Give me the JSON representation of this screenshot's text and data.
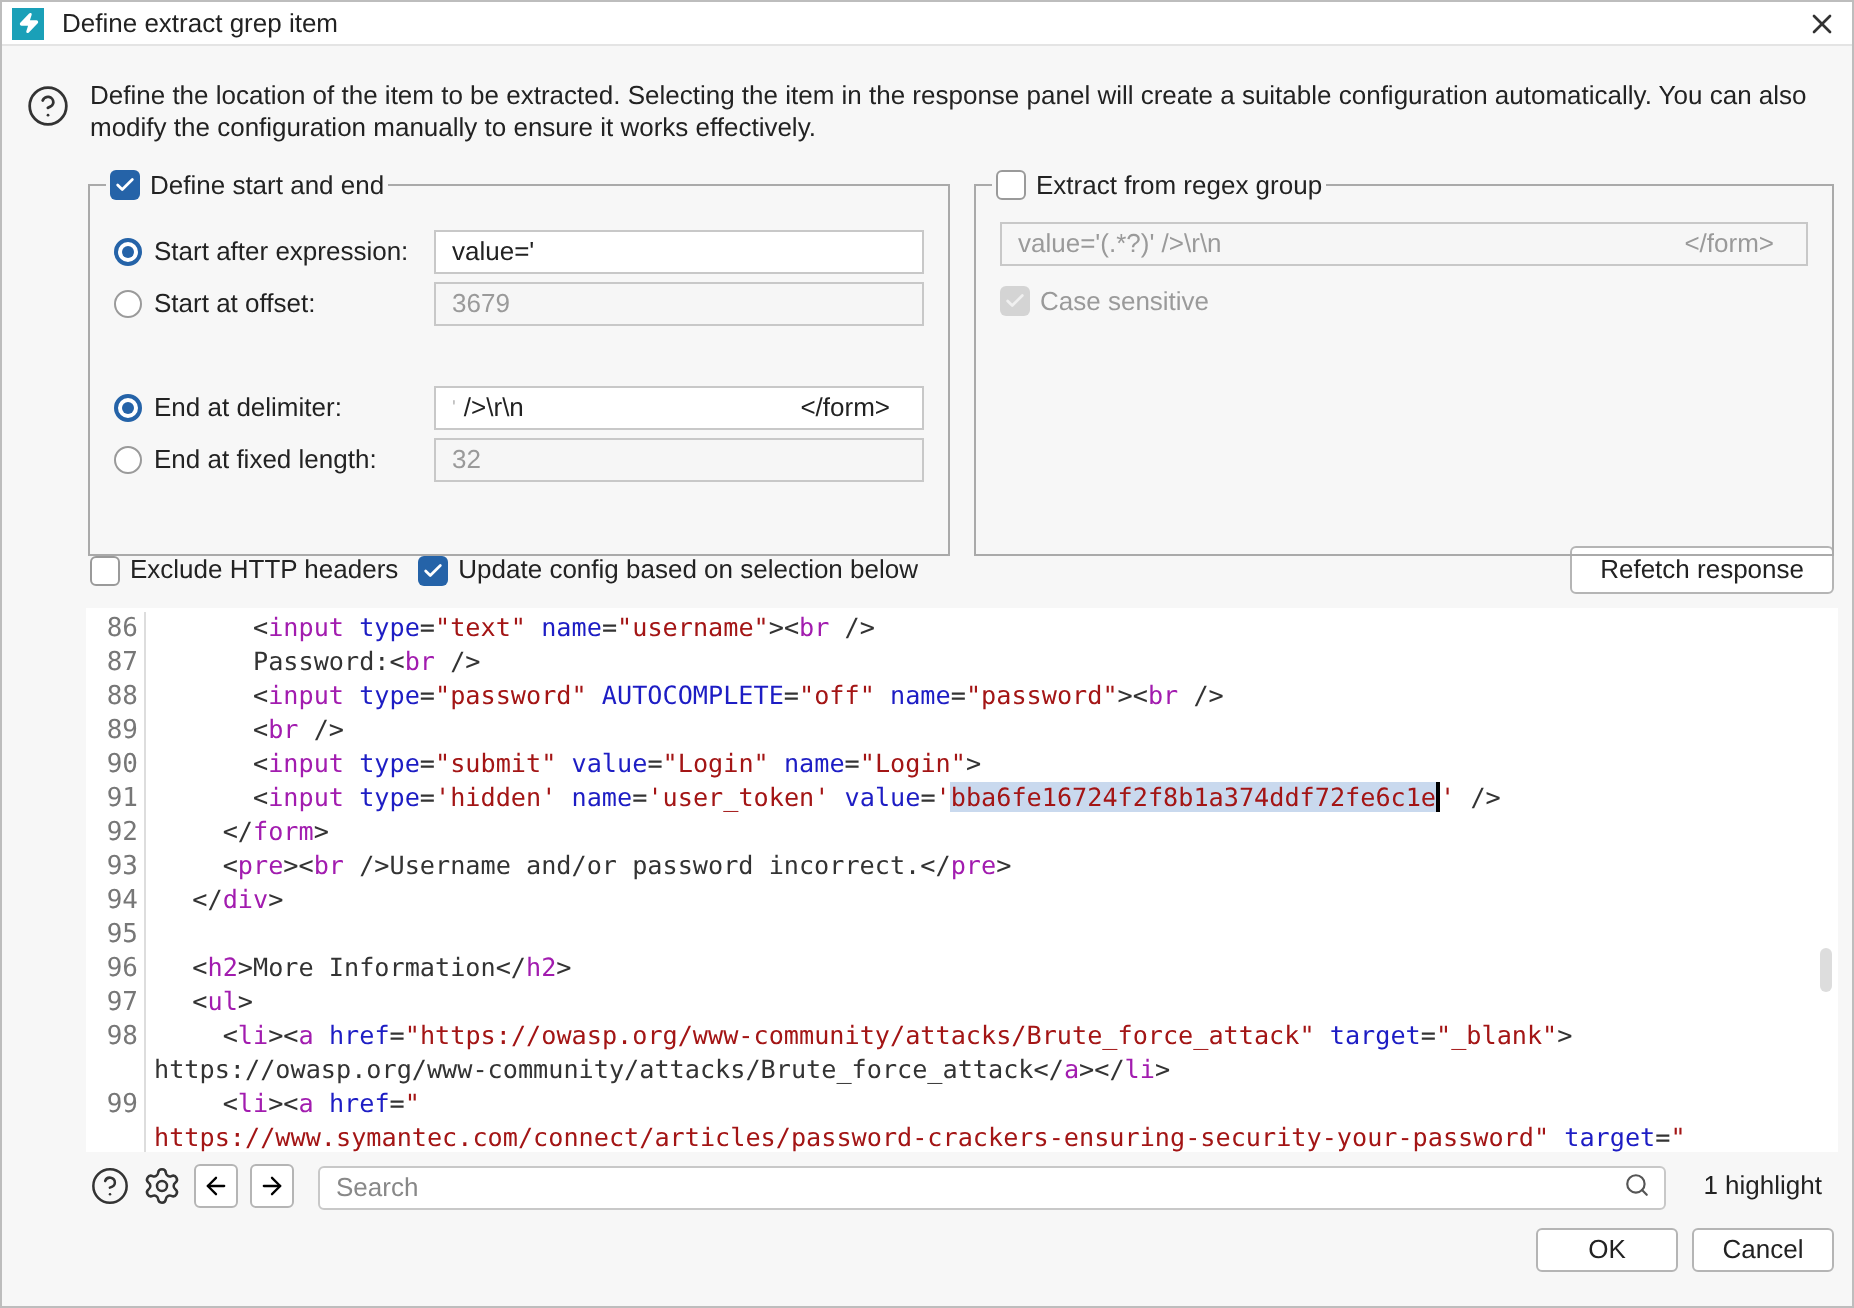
{
  "window": {
    "title": "Define extract grep item"
  },
  "description": "Define the location of the item to be extracted. Selecting the item in the response panel will create a suitable configuration automatically. You can also modify the configuration manually to ensure it works effectively.",
  "start_end": {
    "label": "Define start and end",
    "checked": true,
    "start_options": [
      {
        "label": "Start after expression:",
        "selected": true,
        "field": {
          "value": "value='",
          "disabled": false
        }
      },
      {
        "label": "Start at offset:",
        "selected": false,
        "field": {
          "value": "3679",
          "disabled": true
        }
      }
    ],
    "end_options": [
      {
        "label": "End at delimiter:",
        "selected": true,
        "field": {
          "value_start": "'",
          "value": "/>\\r\\n",
          "value_end": "</form>",
          "disabled": false
        }
      },
      {
        "label": "End at fixed length:",
        "selected": false,
        "field": {
          "value": "32",
          "disabled": true
        }
      }
    ]
  },
  "regex_group": {
    "label": "Extract from regex group",
    "checked": false,
    "field": {
      "value": "value='(.*?)' />\\r\\n",
      "value_end": "</form>",
      "disabled": true
    },
    "case_sensitive": {
      "label": "Case sensitive",
      "checked": true,
      "disabled": true
    }
  },
  "options": [
    {
      "label": "Exclude HTTP headers",
      "checked": false
    },
    {
      "label": "Update config based on selection below",
      "checked": true
    }
  ],
  "refetch_button": "Refetch response",
  "code_lines": [
    {
      "number": "86",
      "tokens": [
        {
          "kind": "punct",
          "text": "      <"
        },
        {
          "kind": "tag",
          "text": "input"
        },
        {
          "kind": "attr",
          "text": " type"
        },
        {
          "kind": "punct",
          "text": "="
        },
        {
          "kind": "string",
          "text": "\"text\""
        },
        {
          "kind": "attr",
          "text": " name"
        },
        {
          "kind": "punct",
          "text": "="
        },
        {
          "kind": "string",
          "text": "\"username\""
        },
        {
          "kind": "punct",
          "text": "><"
        },
        {
          "kind": "tag",
          "text": "br"
        },
        {
          "kind": "punct",
          "text": " />"
        }
      ]
    },
    {
      "number": "87",
      "tokens": [
        {
          "kind": "punct",
          "text": "      Password:<"
        },
        {
          "kind": "tag",
          "text": "br"
        },
        {
          "kind": "punct",
          "text": " />"
        }
      ]
    },
    {
      "number": "88",
      "tokens": [
        {
          "kind": "punct",
          "text": "      <"
        },
        {
          "kind": "tag",
          "text": "input"
        },
        {
          "kind": "attr",
          "text": " type"
        },
        {
          "kind": "punct",
          "text": "="
        },
        {
          "kind": "string",
          "text": "\"password\""
        },
        {
          "kind": "attr",
          "text": " AUTOCOMPLETE"
        },
        {
          "kind": "punct",
          "text": "="
        },
        {
          "kind": "string",
          "text": "\"off\""
        },
        {
          "kind": "attr",
          "text": " name"
        },
        {
          "kind": "punct",
          "text": "="
        },
        {
          "kind": "string",
          "text": "\"password\""
        },
        {
          "kind": "punct",
          "text": "><"
        },
        {
          "kind": "tag",
          "text": "br"
        },
        {
          "kind": "punct",
          "text": " />"
        }
      ]
    },
    {
      "number": "89",
      "tokens": [
        {
          "kind": "punct",
          "text": "      <"
        },
        {
          "kind": "tag",
          "text": "br"
        },
        {
          "kind": "punct",
          "text": " />"
        }
      ]
    },
    {
      "number": "90",
      "tokens": [
        {
          "kind": "punct",
          "text": "      <"
        },
        {
          "kind": "tag",
          "text": "input"
        },
        {
          "kind": "attr",
          "text": " type"
        },
        {
          "kind": "punct",
          "text": "="
        },
        {
          "kind": "string",
          "text": "\"submit\""
        },
        {
          "kind": "attr",
          "text": " value"
        },
        {
          "kind": "punct",
          "text": "="
        },
        {
          "kind": "string",
          "text": "\"Login\""
        },
        {
          "kind": "attr",
          "text": " name"
        },
        {
          "kind": "punct",
          "text": "="
        },
        {
          "kind": "string",
          "text": "\"Login\""
        },
        {
          "kind": "punct",
          "text": ">"
        }
      ]
    },
    {
      "number": "91",
      "tokens": [
        {
          "kind": "punct",
          "text": "      <"
        },
        {
          "kind": "tag",
          "text": "input"
        },
        {
          "kind": "attr",
          "text": " type"
        },
        {
          "kind": "punct",
          "text": "="
        },
        {
          "kind": "string",
          "text": "'hidden'"
        },
        {
          "kind": "attr",
          "text": " name"
        },
        {
          "kind": "punct",
          "text": "="
        },
        {
          "kind": "string",
          "text": "'user_token'"
        },
        {
          "kind": "attr",
          "text": " value"
        },
        {
          "kind": "punct",
          "text": "="
        },
        {
          "kind": "string",
          "text": "'"
        },
        {
          "kind": "string",
          "text": "bba6fe16724f2f8b1a374ddf72fe6c1e",
          "selected": true
        },
        {
          "kind": "string",
          "text": "'"
        },
        {
          "kind": "punct",
          "text": " />"
        }
      ]
    },
    {
      "number": "92",
      "tokens": [
        {
          "kind": "punct",
          "text": "    </"
        },
        {
          "kind": "tag",
          "text": "form"
        },
        {
          "kind": "punct",
          "text": ">"
        }
      ]
    },
    {
      "number": "93",
      "tokens": [
        {
          "kind": "punct",
          "text": "    <"
        },
        {
          "kind": "tag",
          "text": "pre"
        },
        {
          "kind": "punct",
          "text": "><"
        },
        {
          "kind": "tag",
          "text": "br"
        },
        {
          "kind": "punct",
          "text": " />Username and/or password incorrect.</"
        },
        {
          "kind": "tag",
          "text": "pre"
        },
        {
          "kind": "punct",
          "text": ">"
        }
      ]
    },
    {
      "number": "94",
      "tokens": [
        {
          "kind": "punct",
          "text": "  </"
        },
        {
          "kind": "tag",
          "text": "div"
        },
        {
          "kind": "punct",
          "text": ">"
        }
      ]
    },
    {
      "number": "95"
    },
    {
      "number": "96",
      "tokens": [
        {
          "kind": "punct",
          "text": "  <"
        },
        {
          "kind": "tag",
          "text": "h2"
        },
        {
          "kind": "punct",
          "text": ">More Information</"
        },
        {
          "kind": "tag",
          "text": "h2"
        },
        {
          "kind": "punct",
          "text": ">"
        }
      ]
    },
    {
      "number": "97",
      "tokens": [
        {
          "kind": "punct",
          "text": "  <"
        },
        {
          "kind": "tag",
          "text": "ul"
        },
        {
          "kind": "punct",
          "text": ">"
        }
      ]
    },
    {
      "number": "98",
      "tokens": [
        {
          "kind": "punct",
          "text": "    <"
        },
        {
          "kind": "tag",
          "text": "li"
        },
        {
          "kind": "punct",
          "text": "><"
        },
        {
          "kind": "tag",
          "text": "a"
        },
        {
          "kind": "attr",
          "text": " href"
        },
        {
          "kind": "punct",
          "text": "="
        },
        {
          "kind": "string",
          "text": "\"https://owasp.org/www-community/attacks/Brute_force_attack\""
        },
        {
          "kind": "attr",
          "text": " target"
        },
        {
          "kind": "punct",
          "text": "="
        },
        {
          "kind": "string",
          "text": "\"_blank\""
        },
        {
          "kind": "punct",
          "text": ">"
        }
      ]
    },
    {
      "tokens": [
        {
          "kind": "punct",
          "text": "https://owasp.org/www-community/attacks/Brute_force_attack</"
        },
        {
          "kind": "tag",
          "text": "a"
        },
        {
          "kind": "punct",
          "text": "></"
        },
        {
          "kind": "tag",
          "text": "li"
        },
        {
          "kind": "punct",
          "text": ">"
        }
      ]
    },
    {
      "number": "99",
      "tokens": [
        {
          "kind": "punct",
          "text": "    <"
        },
        {
          "kind": "tag",
          "text": "li"
        },
        {
          "kind": "punct",
          "text": "><"
        },
        {
          "kind": "tag",
          "text": "a"
        },
        {
          "kind": "attr",
          "text": " href"
        },
        {
          "kind": "punct",
          "text": "="
        },
        {
          "kind": "string",
          "text": "\""
        }
      ]
    },
    {
      "tokens": [
        {
          "kind": "string",
          "text": "https://www.symantec.com/connect/articles/password-crackers-ensuring-security-your-password\""
        },
        {
          "kind": "attr",
          "text": " target"
        },
        {
          "kind": "punct",
          "text": "="
        },
        {
          "kind": "string",
          "text": "\""
        }
      ]
    }
  ],
  "search": {
    "placeholder": "Search"
  },
  "highlight_count": "1 highlight",
  "buttons": [
    "OK",
    "Cancel"
  ]
}
